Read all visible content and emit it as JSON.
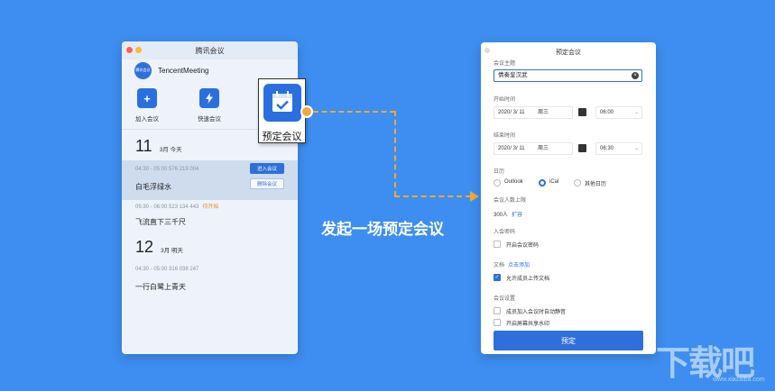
{
  "left_window": {
    "title": "腾讯会议",
    "avatar_text": "腾讯会议",
    "username": "TencentMeeting",
    "actions": [
      {
        "label": "加入会议",
        "icon": "plus-icon"
      },
      {
        "label": "快速会议",
        "icon": "lightning-icon"
      }
    ],
    "days": [
      {
        "day": "11",
        "sub": "3月  今天"
      },
      {
        "day": "12",
        "sub": "3月  明天"
      }
    ],
    "meetings": [
      {
        "time": "04:30 - 05:00  576 219 004",
        "tag": "",
        "name": "白毛浮绿水"
      },
      {
        "time": "05:30 - 06:00  523 134 443",
        "tag": "待开始",
        "name": "飞流直下三千尺"
      },
      {
        "time": "04:30 - 05:00  316 038 247",
        "tag": "",
        "name": "一行白鹭上青天"
      }
    ],
    "join_button": "进入会议",
    "delete_button": "删除会议"
  },
  "popup_label": "预定会议",
  "center_caption": "发起一场预定会议",
  "right_window": {
    "title": "预定会议",
    "topic_label": "会议主题",
    "topic_value": "情奏皇汉武",
    "start_label": "开始时间",
    "start_date": "2020/ 3/ 11",
    "start_weekday": "周三",
    "start_time": "06:00",
    "end_label": "结束时间",
    "end_date": "2020/ 3/ 11",
    "end_weekday": "周三",
    "end_time": "06:30",
    "calendar_label": "日历",
    "calendar_options": [
      {
        "label": "Outlook",
        "selected": false
      },
      {
        "label": "iCal",
        "selected": true
      },
      {
        "label": "其他日历",
        "selected": false
      }
    ],
    "limit_label": "会议人数上限",
    "limit_value": "300人",
    "limit_link": "扩容",
    "password_label": "入会密码",
    "password_check": "开启会议密码",
    "docs_label": "文档",
    "docs_link": "点击添加",
    "docs_check": "允许成员上传文档",
    "settings_label": "会议设置",
    "setting_checks": [
      "成员加入会议时自动静音",
      "开启屏幕共享水印"
    ],
    "submit": "预定"
  },
  "watermark": "下载吧",
  "watermark_url": "www.xiazaiba.com",
  "colors": {
    "background": "#3d8ef0",
    "accent": "#2f6fdb",
    "connector": "#f2a935"
  }
}
